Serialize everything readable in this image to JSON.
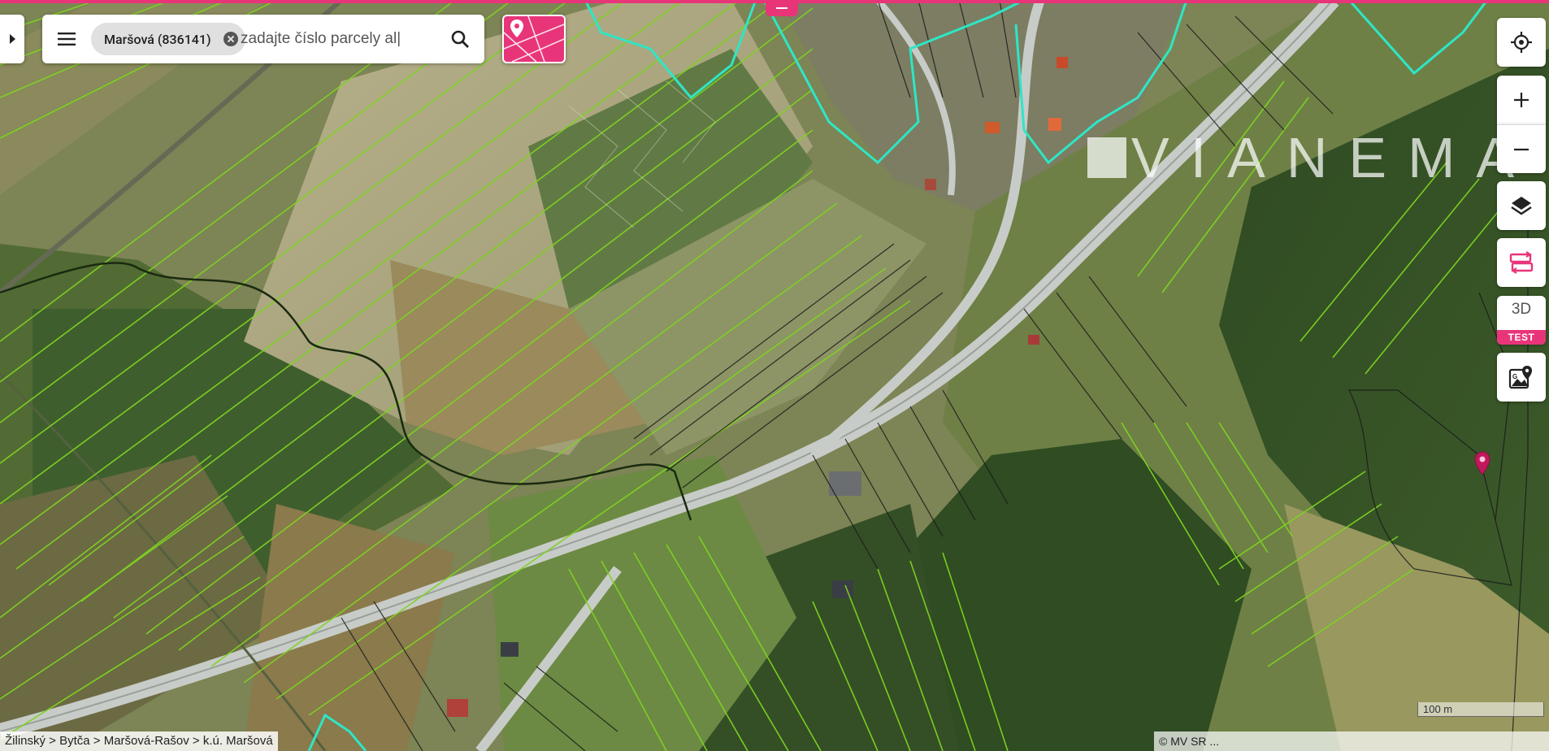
{
  "search": {
    "chip_label": "Maršová (836141)",
    "placeholder": "zadajte číslo parcely al|"
  },
  "controls": {
    "locate": "locate-icon",
    "zoom_in": "+",
    "zoom_out": "−",
    "layers": "layers-icon",
    "compare": "compare-icon",
    "btn_3d_label": "3D",
    "btn_3d_badge": "TEST",
    "streetview": "streetview-icon"
  },
  "watermark": "VIANEMA",
  "breadcrumb": "Žilinský > Bytča > Maršová-Rašov > k.ú. Maršová",
  "attribution": "© MV SR ...",
  "scale_label": "100 m",
  "colors": {
    "accent": "#e8357a",
    "parcel_lines": "#7ed321",
    "boundary_cyan": "#2ee6c6",
    "pin": "#c2185b"
  }
}
